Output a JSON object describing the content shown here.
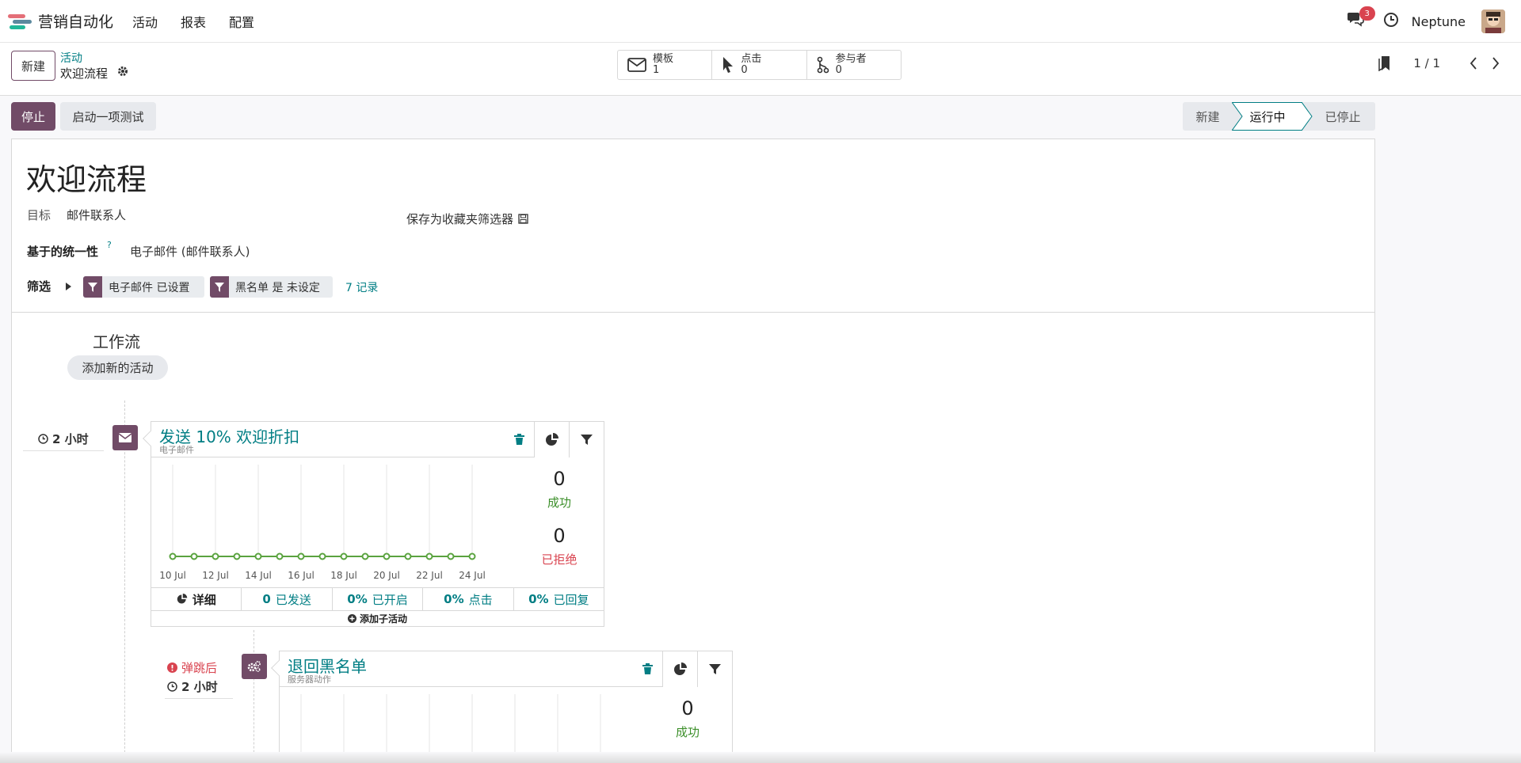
{
  "navbar": {
    "app_title": "营销自动化",
    "menu": [
      "活动",
      "报表",
      "配置"
    ],
    "chat_badge": "3",
    "user_name": "Neptune"
  },
  "control": {
    "new_label": "新建",
    "breadcrumb_parent": "活动",
    "breadcrumb_current": "欢迎流程",
    "smart_buttons": [
      {
        "label": "模板",
        "value": "1",
        "icon": "envelope-icon"
      },
      {
        "label": "点击",
        "value": "0",
        "icon": "cursor-icon"
      },
      {
        "label": "参与者",
        "value": "0",
        "icon": "branch-icon"
      }
    ],
    "pager": "1 / 1"
  },
  "statusbar": {
    "stop_label": "停止",
    "test_label": "启动一项测试",
    "stages": [
      "新建",
      "运行中",
      "已停止"
    ],
    "active_stage": "运行中"
  },
  "form": {
    "title": "欢迎流程",
    "target_label": "目标",
    "target_value": "邮件联系人",
    "save_filter": "保存为收藏夹筛选器",
    "unique_label": "基于的统一性",
    "unique_help": "?",
    "unique_value": "电子邮件 (邮件联系人)",
    "filter_label": "筛选",
    "filter_chips": [
      "电子邮件 已设置",
      "黑名单 是 未设定"
    ],
    "record_count": "7 记录"
  },
  "workflow": {
    "title": "工作流",
    "add_activity": "添加新的活动",
    "activities": [
      {
        "trigger": "2 小时",
        "title": "发送 10% 欢迎折扣",
        "type": "电子邮件",
        "success_count": "0",
        "success_label": "成功",
        "rejected_count": "0",
        "rejected_label": "已拒绝",
        "footer": {
          "details": "详细",
          "sent_value": "0",
          "sent_label": "已发送",
          "opened_value": "0%",
          "opened_label": "已开启",
          "clicked_value": "0%",
          "clicked_label": "点击",
          "replied_value": "0%",
          "replied_label": "已回复"
        },
        "add_child": "添加子活动"
      },
      {
        "trigger_event": "弹跳后",
        "trigger": "2 小时",
        "title": "退回黑名单",
        "type": "服务器动作",
        "success_count": "0",
        "success_label": "成功"
      }
    ]
  },
  "chart_data": {
    "type": "line",
    "x": [
      "10 Jul",
      "11 Jul",
      "12 Jul",
      "13 Jul",
      "14 Jul",
      "15 Jul",
      "16 Jul",
      "17 Jul",
      "18 Jul",
      "19 Jul",
      "20 Jul",
      "21 Jul",
      "22 Jul",
      "23 Jul",
      "24 Jul"
    ],
    "tick_labels": [
      "10 Jul",
      "12 Jul",
      "14 Jul",
      "16 Jul",
      "18 Jul",
      "20 Jul",
      "22 Jul",
      "24 Jul"
    ],
    "series": [
      {
        "values": [
          0,
          0,
          0,
          0,
          0,
          0,
          0,
          0,
          0,
          0,
          0,
          0,
          0,
          0,
          0
        ],
        "color": "#5aa33f"
      }
    ],
    "grid": "vertical"
  },
  "colors": {
    "brand": "#714b67",
    "accent": "#017e84",
    "success": "#3c8f2a",
    "danger": "#d9434f"
  }
}
